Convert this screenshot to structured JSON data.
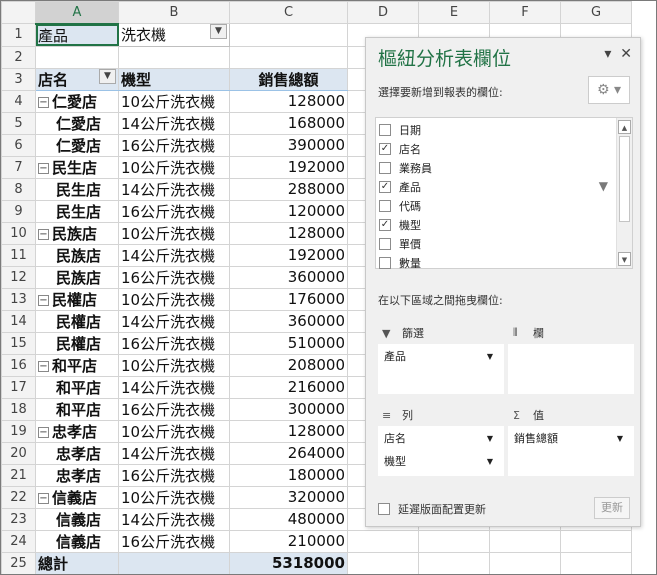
{
  "columns": [
    "A",
    "B",
    "C",
    "D",
    "E",
    "F",
    "G"
  ],
  "row_numbers": [
    "1",
    "2",
    "3",
    "4",
    "5",
    "6",
    "7",
    "8",
    "9",
    "10",
    "11",
    "12",
    "13",
    "14",
    "15",
    "16",
    "17",
    "18",
    "19",
    "20",
    "21",
    "22",
    "23",
    "24",
    "25"
  ],
  "filter_row": {
    "label": "產品",
    "value": "洗衣機"
  },
  "headers": {
    "store": "店名",
    "model": "機型",
    "sales": "銷售總額"
  },
  "rows": [
    {
      "store": "仁愛店",
      "model": "10公斤洗衣機",
      "sales": "128000",
      "first": true
    },
    {
      "store": "仁愛店",
      "model": "14公斤洗衣機",
      "sales": "168000",
      "first": false
    },
    {
      "store": "仁愛店",
      "model": "16公斤洗衣機",
      "sales": "390000",
      "first": false
    },
    {
      "store": "民生店",
      "model": "10公斤洗衣機",
      "sales": "192000",
      "first": true
    },
    {
      "store": "民生店",
      "model": "14公斤洗衣機",
      "sales": "288000",
      "first": false
    },
    {
      "store": "民生店",
      "model": "16公斤洗衣機",
      "sales": "120000",
      "first": false
    },
    {
      "store": "民族店",
      "model": "10公斤洗衣機",
      "sales": "128000",
      "first": true
    },
    {
      "store": "民族店",
      "model": "14公斤洗衣機",
      "sales": "192000",
      "first": false
    },
    {
      "store": "民族店",
      "model": "16公斤洗衣機",
      "sales": "360000",
      "first": false
    },
    {
      "store": "民權店",
      "model": "10公斤洗衣機",
      "sales": "176000",
      "first": true
    },
    {
      "store": "民權店",
      "model": "14公斤洗衣機",
      "sales": "360000",
      "first": false
    },
    {
      "store": "民權店",
      "model": "16公斤洗衣機",
      "sales": "510000",
      "first": false
    },
    {
      "store": "和平店",
      "model": "10公斤洗衣機",
      "sales": "208000",
      "first": true
    },
    {
      "store": "和平店",
      "model": "14公斤洗衣機",
      "sales": "216000",
      "first": false
    },
    {
      "store": "和平店",
      "model": "16公斤洗衣機",
      "sales": "300000",
      "first": false
    },
    {
      "store": "忠孝店",
      "model": "10公斤洗衣機",
      "sales": "128000",
      "first": true
    },
    {
      "store": "忠孝店",
      "model": "14公斤洗衣機",
      "sales": "264000",
      "first": false
    },
    {
      "store": "忠孝店",
      "model": "16公斤洗衣機",
      "sales": "180000",
      "first": false
    },
    {
      "store": "信義店",
      "model": "10公斤洗衣機",
      "sales": "320000",
      "first": true
    },
    {
      "store": "信義店",
      "model": "14公斤洗衣機",
      "sales": "480000",
      "first": false
    },
    {
      "store": "信義店",
      "model": "16公斤洗衣機",
      "sales": "210000",
      "first": false
    }
  ],
  "total": {
    "label": "總計",
    "value": "5318000"
  },
  "panel": {
    "title": "樞紐分析表欄位",
    "subtitle": "選擇要新增到報表的欄位:",
    "fields": [
      {
        "label": "日期",
        "checked": false
      },
      {
        "label": "店名",
        "checked": true
      },
      {
        "label": "業務員",
        "checked": false
      },
      {
        "label": "產品",
        "checked": true
      },
      {
        "label": "代碼",
        "checked": false
      },
      {
        "label": "機型",
        "checked": true
      },
      {
        "label": "單價",
        "checked": false
      },
      {
        "label": "數量",
        "checked": false
      }
    ],
    "drag_text": "在以下區域之間拖曳欄位:",
    "filters_label": "篩選",
    "columns_label": "欄",
    "rows_label": "列",
    "values_label": "值",
    "filter_items": [
      "產品"
    ],
    "row_items": [
      "店名",
      "機型"
    ],
    "value_items": [
      "銷售總額"
    ],
    "defer_label": "延遲版面配置更新",
    "update_label": "更新"
  },
  "colors": {
    "accent": "#217346",
    "pivot_header_fill": "#dce6f1"
  }
}
